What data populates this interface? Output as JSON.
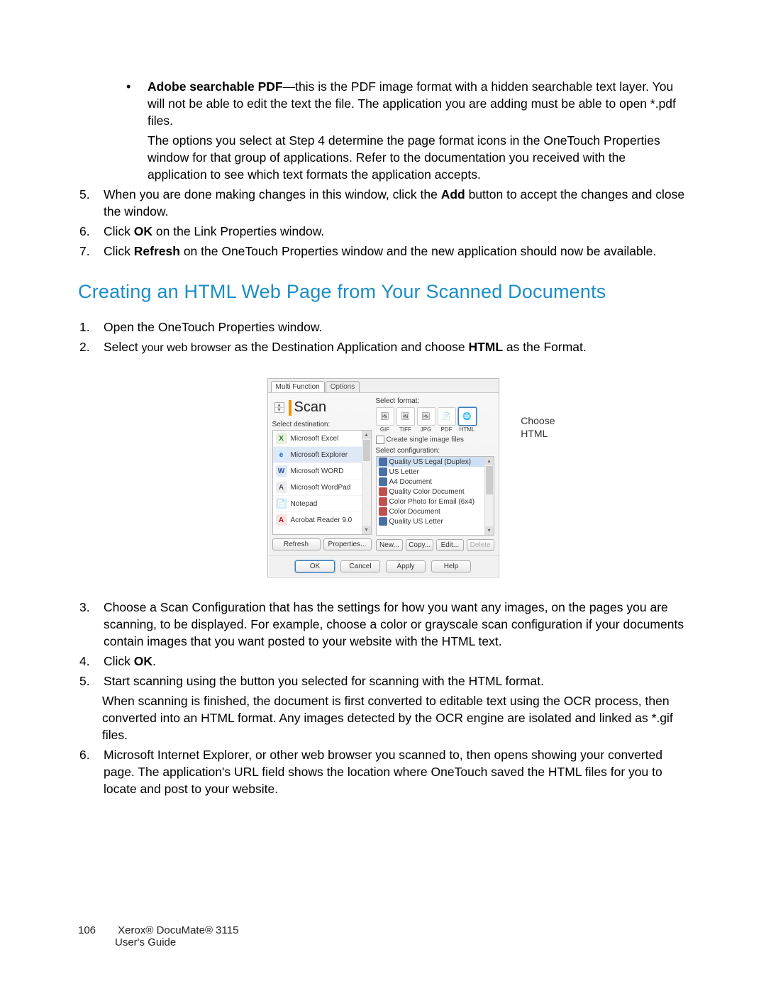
{
  "bullet": {
    "bold": "Adobe searchable PDF",
    "text": "—this is the PDF image format with a hidden searchable text layer. You will not be able to edit the text the file. The application you are adding must be able to open *.pdf files.",
    "sub": "The options you select at Step 4 determine the page format icons in the OneTouch Properties window for that group of applications. Refer to the documentation you received with the application to see which text formats the application accepts."
  },
  "top_list": {
    "n5": "5.",
    "t5a": "When you are done making changes in this window, click the ",
    "t5b": "Add",
    "t5c": " button to accept the changes and close the window.",
    "n6": "6.",
    "t6a": "Click ",
    "t6b": "OK",
    "t6c": " on the Link Properties window.",
    "n7": "7.",
    "t7a": "Click ",
    "t7b": "Refresh",
    "t7c": " on the OneTouch Properties window and the new application should now be available."
  },
  "heading": "Creating an HTML Web Page from Your Scanned Documents",
  "mid_list": {
    "n1": "1.",
    "t1": "Open the OneTouch Properties window.",
    "n2": "2.",
    "t2a": "Select ",
    "t2b": "your web browser",
    "t2c": " as the Destination Application and choose ",
    "t2d": "HTML",
    "t2e": " as the Format."
  },
  "dialog": {
    "tab1": "Multi Function",
    "tab2": "Options",
    "scan": "Scan",
    "sel_dest": "Select destination:",
    "dests": [
      "Microsoft Excel",
      "Microsoft Explorer",
      "Microsoft WORD",
      "Microsoft WordPad",
      "Notepad",
      "Acrobat Reader 9.0"
    ],
    "sel_fmt": "Select format:",
    "fmts": [
      "GIF",
      "TIFF",
      "JPG",
      "PDF",
      "HTML"
    ],
    "chk": "Create single image files",
    "sel_cfg": "Select configuration:",
    "cfgs": [
      "Quality US Legal (Duplex)",
      "US Letter",
      "A4 Document",
      "Quality Color Document",
      "Color Photo for Email (6x4)",
      "Color Document",
      "Quality US Letter"
    ],
    "refresh": "Refresh",
    "props": "Properties...",
    "new": "New...",
    "copy": "Copy...",
    "edit": "Edit...",
    "del": "Delete",
    "ok": "OK",
    "cancel": "Cancel",
    "apply": "Apply",
    "help": "Help",
    "callout1": "Choose",
    "callout2": "HTML"
  },
  "bot_list": {
    "n3": "3.",
    "t3": "Choose a Scan Configuration that has the settings for how you want any images, on the pages you are scanning, to be displayed. For example, choose a color or grayscale scan configuration if your documents contain images that you want posted to your website with the HTML text.",
    "n4": "4.",
    "t4a": "Click ",
    "t4b": "OK",
    "t4c": ".",
    "n5": "5.",
    "t5": "Start scanning using the button you selected for scanning with the HTML format.",
    "t5sub": "When scanning is finished, the document is first converted to editable text using the OCR process, then converted into an HTML format. Any images detected by the OCR engine are isolated and linked as *.gif files.",
    "n6": "6.",
    "t6": "Microsoft Internet Explorer, or other web browser you scanned to, then opens showing your converted page. The application's URL field shows the location where OneTouch saved the HTML files for you to locate and post to your website."
  },
  "footer": {
    "page": "106",
    "line1": "Xerox® DocuMate® 3115",
    "line2": "User's Guide"
  }
}
